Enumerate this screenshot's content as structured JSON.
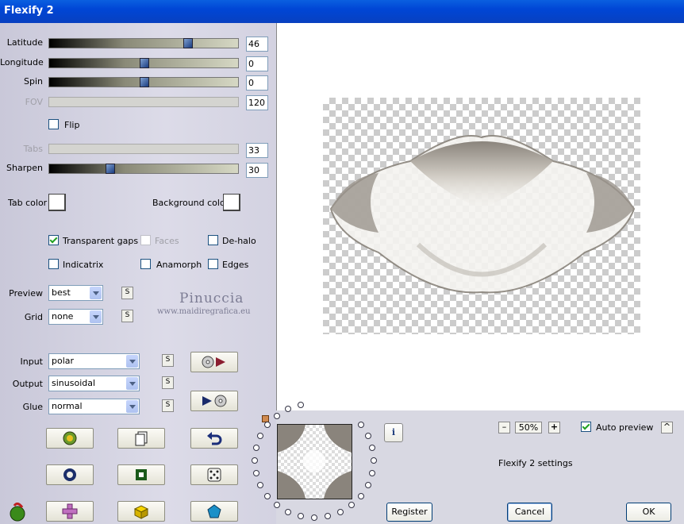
{
  "window": {
    "title": "Flexify 2"
  },
  "sliders": [
    {
      "key": "latitude",
      "label": "Latitude",
      "value": "46",
      "level": 0.74,
      "enabled": true
    },
    {
      "key": "longitude",
      "label": "Longitude",
      "value": "0",
      "level": 0.5,
      "enabled": true
    },
    {
      "key": "spin",
      "label": "Spin",
      "value": "0",
      "level": 0.5,
      "enabled": true
    },
    {
      "key": "fov",
      "label": "FOV",
      "value": "120",
      "level": null,
      "enabled": false
    },
    {
      "key": "tabs",
      "label": "Tabs",
      "value": "33",
      "level": null,
      "enabled": false
    },
    {
      "key": "sharpen",
      "label": "Sharpen",
      "value": "30",
      "level": 0.31,
      "enabled": true
    }
  ],
  "flip": {
    "label": "Flip",
    "checked": false
  },
  "colors": {
    "tab_color_label": "Tab color",
    "background_color_label": "Background color",
    "tab_color": "#ffffff",
    "background_color": "#ffffff"
  },
  "options": {
    "transparent_gaps": {
      "label": "Transparent gaps",
      "checked": true
    },
    "faces": {
      "label": "Faces",
      "checked": false,
      "enabled": false
    },
    "de_halo": {
      "label": "De-halo",
      "checked": false
    },
    "indicatrix": {
      "label": "Indicatrix",
      "checked": false
    },
    "anamorph": {
      "label": "Anamorph",
      "checked": false
    },
    "edges": {
      "label": "Edges",
      "checked": false
    }
  },
  "preview_select": {
    "label": "Preview",
    "value": "best"
  },
  "grid_select": {
    "label": "Grid",
    "value": "none"
  },
  "watermark": {
    "name": "Pinuccia",
    "url": "www.maidiregrafica.eu"
  },
  "input_select": {
    "label": "Input",
    "value": "polar"
  },
  "output_select": {
    "label": "Output",
    "value": "sinusoidal"
  },
  "glue_select": {
    "label": "Glue",
    "value": "normal"
  },
  "s_button_label": "S",
  "zoom": {
    "value": "50%",
    "minus": "–",
    "plus": "+"
  },
  "auto_preview": {
    "label": "Auto preview",
    "checked": true
  },
  "caret_button_label": "^",
  "info_button_label": "i",
  "settings_text": "Flexify 2 settings",
  "buttons": {
    "register": "Register",
    "cancel": "Cancel",
    "ok": "OK"
  },
  "accent_colors": {
    "title_bar": "#0046d5",
    "check": "#21a121",
    "thumb": "#1a3c80"
  }
}
